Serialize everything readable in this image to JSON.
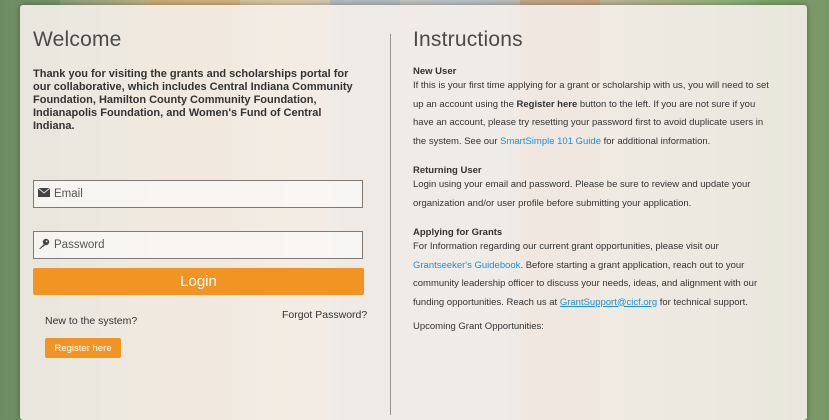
{
  "welcome": {
    "title": "Welcome",
    "intro": "Thank you for visiting the grants and scholarships portal for our collaborative, which includes Central Indiana Community Foundation, Hamilton County Community Foundation, Indianapolis Foundation, and Women's Fund of Central Indiana.",
    "email_placeholder": "Email",
    "password_placeholder": "Password",
    "login_label": "Login",
    "new_to_system": "New to the system?",
    "forgot_password": "Forgot Password?",
    "register_label": "Register here"
  },
  "instructions": {
    "title": "Instructions",
    "new_user": {
      "heading": "New User",
      "text_1": "If this is your first time applying for a grant or scholarship with us, you will need to set up an account using the ",
      "bold": "Register here",
      "text_2": " button to the left. If you are not sure if you have an account, please try resetting your password first to avoid duplicate users in the system. See our ",
      "link": "SmartSimple 101 Guide",
      "text_3": " for additional information."
    },
    "returning_user": {
      "heading": "Returning User",
      "text": "Login using your email and password. Please be sure to review and update your organization and/or user profile before submitting your application."
    },
    "applying": {
      "heading": "Applying for Grants",
      "text_1": "For Information regarding our current grant opportunities, please visit our ",
      "link": "Grantseeker's Guidebook",
      "text_2": ". Before starting a grant application, reach out to your community leadership officer to discuss your needs, ideas, and alignment with our funding opportunities. Reach us at ",
      "email": "GrantSupport@cicf.org",
      "text_3": " for technical support."
    },
    "upcoming": "Upcoming Grant Opportunities:"
  },
  "colors": {
    "accent": "#f29423",
    "link": "#1a8fd8"
  },
  "icons": {
    "email": "envelope-icon",
    "password": "key-icon"
  }
}
